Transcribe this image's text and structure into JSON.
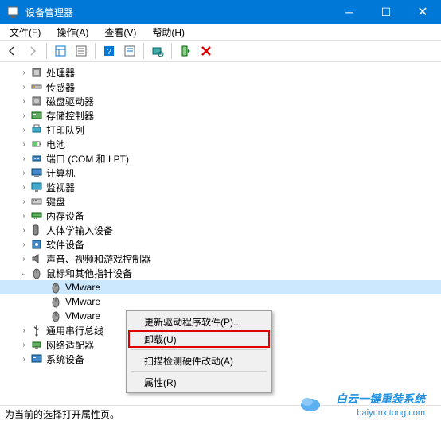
{
  "window": {
    "title": "设备管理器"
  },
  "menubar": [
    {
      "label": "文件(F)"
    },
    {
      "label": "操作(A)"
    },
    {
      "label": "查看(V)"
    },
    {
      "label": "帮助(H)"
    }
  ],
  "tree": [
    {
      "label": "处理器",
      "icon": "cpu"
    },
    {
      "label": "传感器",
      "icon": "sensor"
    },
    {
      "label": "磁盘驱动器",
      "icon": "disk"
    },
    {
      "label": "存储控制器",
      "icon": "storage"
    },
    {
      "label": "打印队列",
      "icon": "printer"
    },
    {
      "label": "电池",
      "icon": "battery"
    },
    {
      "label": "端口 (COM 和 LPT)",
      "icon": "port"
    },
    {
      "label": "计算机",
      "icon": "computer"
    },
    {
      "label": "监视器",
      "icon": "monitor"
    },
    {
      "label": "键盘",
      "icon": "keyboard"
    },
    {
      "label": "内存设备",
      "icon": "memory"
    },
    {
      "label": "人体学输入设备",
      "icon": "hid"
    },
    {
      "label": "软件设备",
      "icon": "software"
    },
    {
      "label": "声音、视频和游戏控制器",
      "icon": "sound"
    },
    {
      "label": "鼠标和其他指针设备",
      "icon": "mouse",
      "expanded": true,
      "children": [
        {
          "label": "VMware",
          "icon": "mouse",
          "selected": true
        },
        {
          "label": "VMware",
          "icon": "mouse"
        },
        {
          "label": "VMware",
          "icon": "mouse"
        }
      ]
    },
    {
      "label": "通用串行总线",
      "icon": "usb"
    },
    {
      "label": "网络适配器",
      "icon": "network"
    },
    {
      "label": "系统设备",
      "icon": "system"
    }
  ],
  "context_menu": [
    {
      "label": "更新驱动程序软件(P)...",
      "type": "item"
    },
    {
      "label": "卸载(U)",
      "type": "item",
      "highlighted": true
    },
    {
      "type": "sep"
    },
    {
      "label": "扫描检测硬件改动(A)",
      "type": "item"
    },
    {
      "type": "sep"
    },
    {
      "label": "属性(R)",
      "type": "item"
    }
  ],
  "statusbar": "为当前的选择打开属性页。",
  "watermark": {
    "main": "白云一键重装系统",
    "sub": "baiyunxitong.com"
  }
}
